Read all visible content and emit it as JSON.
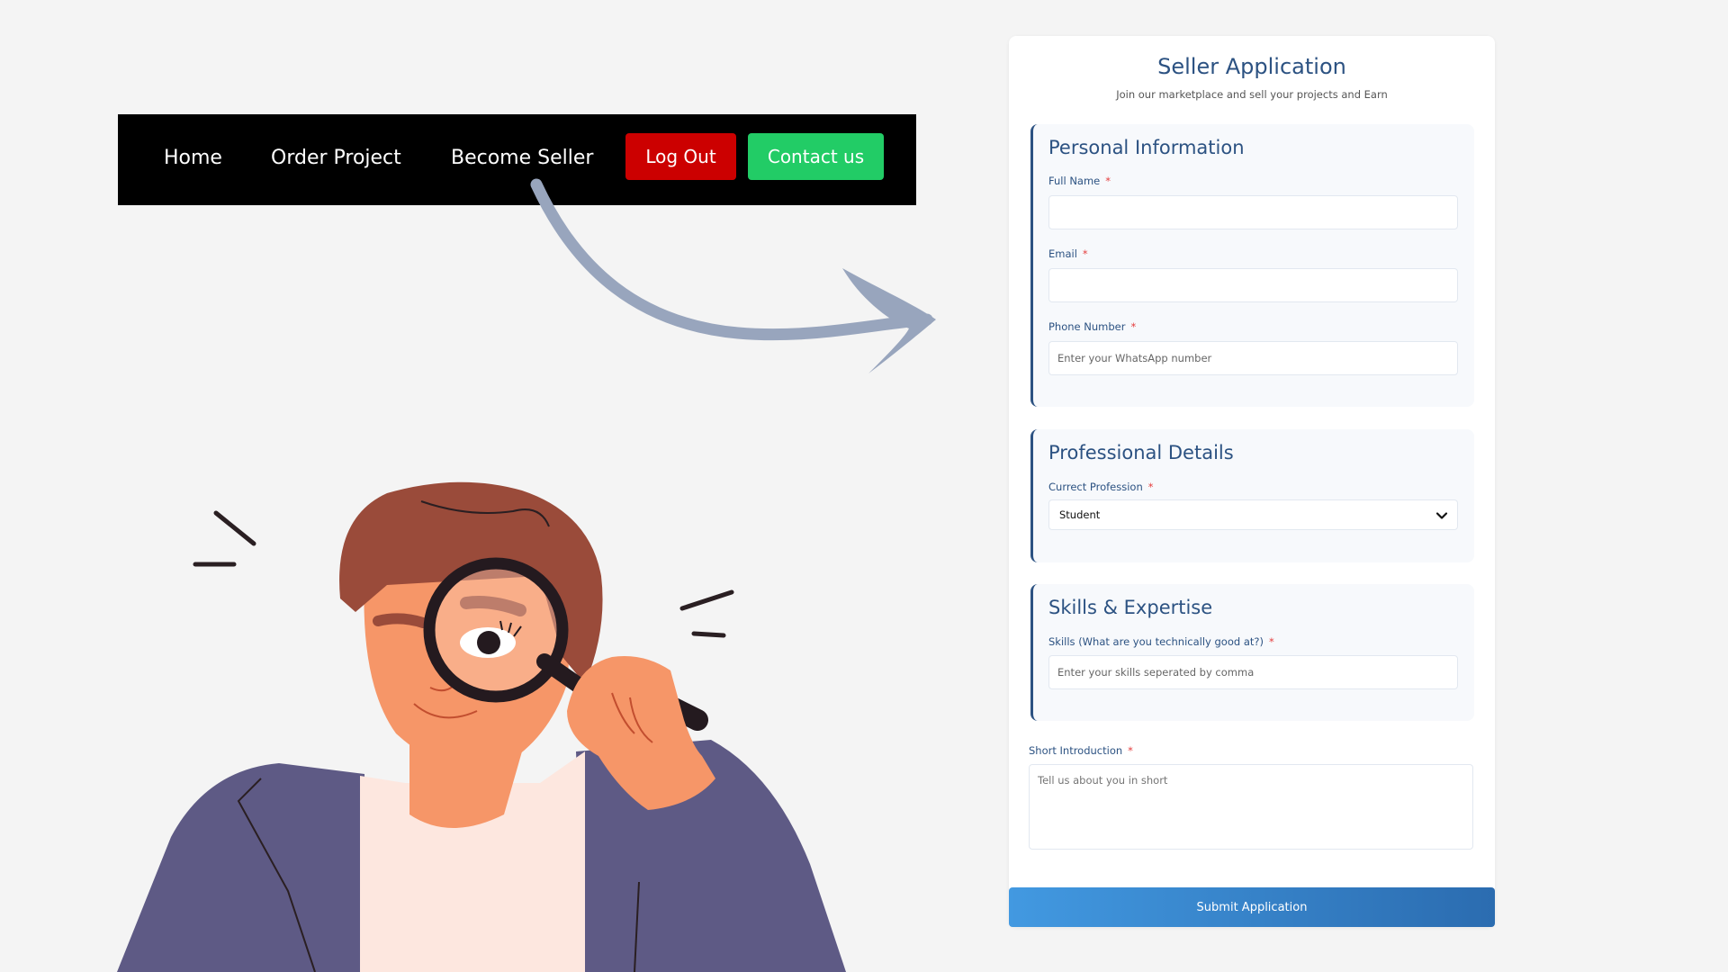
{
  "nav": {
    "home": "Home",
    "order_project": "Order Project",
    "become_seller": "Become Seller",
    "logout": "Log Out",
    "contact": "Contact us"
  },
  "colors": {
    "nav_bg": "#000000",
    "logout_bg": "#cc0000",
    "contact_bg": "#22cc66",
    "form_accent": "#2c5282",
    "required": "#e53e3e",
    "submit_gradient_start": "#4299e1",
    "submit_gradient_end": "#2b6cb0",
    "arrow": "#98a5bd"
  },
  "form": {
    "title": "Seller Application",
    "subtitle": "Join our marketplace and sell your projects and Earn",
    "required_mark": "*",
    "personal": {
      "title": "Personal Information",
      "full_name_label": "Full Name",
      "full_name_value": "",
      "email_label": "Email",
      "email_value": "",
      "phone_label": "Phone Number",
      "phone_placeholder": "Enter your WhatsApp number"
    },
    "professional": {
      "title": "Professional Details",
      "profession_label": "Currect Profession",
      "profession_value": "Student"
    },
    "skills": {
      "title": "Skills & Expertise",
      "skills_label": "Skills (What are you technically good at?)",
      "skills_placeholder": "Enter your skills seperated by comma"
    },
    "intro": {
      "label": "Short Introduction",
      "placeholder": "Tell us about you in short"
    },
    "submit_label": "Submit Application"
  },
  "icons": {
    "select_chevron": "chevron-down-icon",
    "textarea_resize": "resize-handle-icon",
    "arrow": "curved-arrow-icon"
  }
}
